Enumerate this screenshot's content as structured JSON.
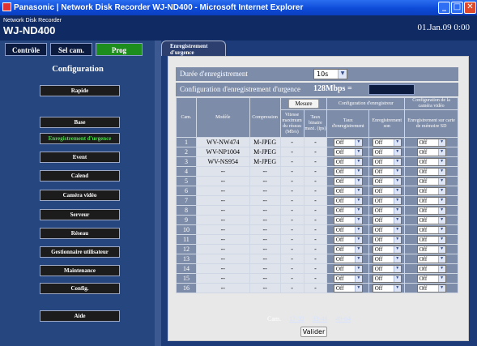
{
  "window": {
    "title": "Panasonic | Network Disk Recorder WJ-ND400 - Microsoft Internet Explorer"
  },
  "header": {
    "model_sub": "Network Disk Recorder",
    "model": "WJ-ND400",
    "datetime": "01.Jan.09  0:00"
  },
  "mode_tabs": [
    "Contrôle",
    "Sel cam.",
    "Prog"
  ],
  "sidebar": {
    "title": "Configuration",
    "items": [
      "Rapide",
      "Base",
      "Enregistrement d'urgence",
      "Event",
      "Calend",
      "Caméra vidéo",
      "Serveur",
      "Réseau",
      "Gestionnaire utilisateur",
      "Maintenance",
      "Config.",
      "Aide"
    ],
    "active_index": 2
  },
  "page": {
    "tab": "Enregistrement d'urgence",
    "duree_label": "Durée d'enregistrement",
    "duree_value": "10s",
    "conf_label": "Configuration d'enregistrement d'urgence",
    "conf_value": "128Mbps ="
  },
  "table": {
    "h_cam": "Cam.",
    "h_modele": "Modèle",
    "h_compression": "Compression",
    "mesure": "Mesure",
    "h_vitesse": "Vitesse maximum du réseau (Mb/s)",
    "h_taux_bits": "Taux binaire maxi. (ips)",
    "h_config_enr": "Configuration d'enregistreur",
    "h_taux_enr": "Taux d'enregistrement",
    "h_enr_son": "Enregistrement son",
    "h_config_cam": "Configuration de la caméra vidéo",
    "h_carte_sd": "Enregistrement sur carte de mémoire SD",
    "rows": [
      {
        "cam": "1",
        "modele": "WV-NW474",
        "comp": "M-JPEG",
        "vit": "-",
        "taux": "-",
        "enr": "Off",
        "son": "Off",
        "sd": "Off"
      },
      {
        "cam": "2",
        "modele": "WV-NP1004",
        "comp": "M-JPEG",
        "vit": "-",
        "taux": "-",
        "enr": "Off",
        "son": "Off",
        "sd": "Off"
      },
      {
        "cam": "3",
        "modele": "WV-NS954",
        "comp": "M-JPEG",
        "vit": "-",
        "taux": "-",
        "enr": "Off",
        "son": "Off",
        "sd": "Off"
      },
      {
        "cam": "4",
        "modele": "--",
        "comp": "--",
        "vit": "-",
        "taux": "-",
        "enr": "Off",
        "son": "Off",
        "sd": "Off"
      },
      {
        "cam": "5",
        "modele": "--",
        "comp": "--",
        "vit": "-",
        "taux": "-",
        "enr": "Off",
        "son": "Off",
        "sd": "Off"
      },
      {
        "cam": "6",
        "modele": "--",
        "comp": "--",
        "vit": "-",
        "taux": "-",
        "enr": "Off",
        "son": "Off",
        "sd": "Off"
      },
      {
        "cam": "7",
        "modele": "--",
        "comp": "--",
        "vit": "-",
        "taux": "-",
        "enr": "Off",
        "son": "Off",
        "sd": "Off"
      },
      {
        "cam": "8",
        "modele": "--",
        "comp": "--",
        "vit": "-",
        "taux": "-",
        "enr": "Off",
        "son": "Off",
        "sd": "Off"
      },
      {
        "cam": "9",
        "modele": "--",
        "comp": "--",
        "vit": "-",
        "taux": "-",
        "enr": "Off",
        "son": "Off",
        "sd": "Off"
      },
      {
        "cam": "10",
        "modele": "--",
        "comp": "--",
        "vit": "-",
        "taux": "-",
        "enr": "Off",
        "son": "Off",
        "sd": "Off"
      },
      {
        "cam": "11",
        "modele": "--",
        "comp": "--",
        "vit": "-",
        "taux": "-",
        "enr": "Off",
        "son": "Off",
        "sd": "Off"
      },
      {
        "cam": "12",
        "modele": "--",
        "comp": "--",
        "vit": "-",
        "taux": "-",
        "enr": "Off",
        "son": "Off",
        "sd": "Off"
      },
      {
        "cam": "13",
        "modele": "--",
        "comp": "--",
        "vit": "-",
        "taux": "-",
        "enr": "Off",
        "son": "Off",
        "sd": "Off"
      },
      {
        "cam": "14",
        "modele": "--",
        "comp": "--",
        "vit": "-",
        "taux": "-",
        "enr": "Off",
        "son": "Off",
        "sd": "Off"
      },
      {
        "cam": "15",
        "modele": "--",
        "comp": "--",
        "vit": "-",
        "taux": "-",
        "enr": "Off",
        "son": "Off",
        "sd": "Off"
      },
      {
        "cam": "16",
        "modele": "--",
        "comp": "--",
        "vit": "-",
        "taux": "-",
        "enr": "Off",
        "son": "Off",
        "sd": "Off"
      }
    ]
  },
  "pager": {
    "label": "Cam.",
    "pages": [
      "17-32",
      "33-48",
      "49-64"
    ]
  },
  "valider": "Valider",
  "colors": {
    "titlebar": "#0d4bd8",
    "panel": "#1c3b78",
    "active_tab": "#1d8d1d",
    "active_item": "#4ed84e",
    "row": "#7d8ca8"
  }
}
